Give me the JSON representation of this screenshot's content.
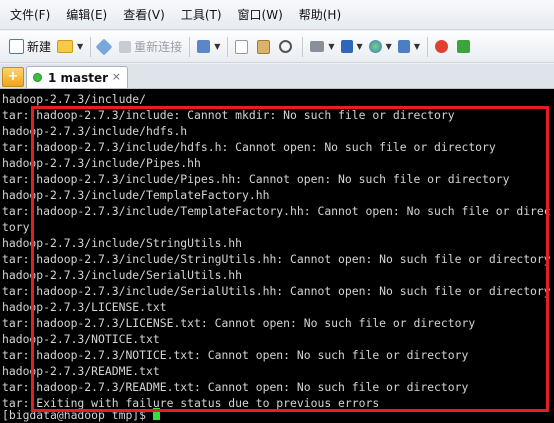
{
  "menu": [
    "文件(F)",
    "编辑(E)",
    "查看(V)",
    "工具(T)",
    "窗口(W)",
    "帮助(H)"
  ],
  "toolbar": {
    "new_label": "新建",
    "reconnect_label": "重新连接"
  },
  "tab": {
    "label": "1 master",
    "close": "×",
    "add": "+"
  },
  "terminal": {
    "lines": [
      "hadoop-2.7.3/include/",
      "tar: hadoop-2.7.3/include: Cannot mkdir: No such file or directory",
      "hadoop-2.7.3/include/hdfs.h",
      "tar: hadoop-2.7.3/include/hdfs.h: Cannot open: No such file or directory",
      "hadoop-2.7.3/include/Pipes.hh",
      "tar: hadoop-2.7.3/include/Pipes.hh: Cannot open: No such file or directory",
      "hadoop-2.7.3/include/TemplateFactory.hh",
      "tar: hadoop-2.7.3/include/TemplateFactory.hh: Cannot open: No such file or direc",
      "tory",
      "hadoop-2.7.3/include/StringUtils.hh",
      "tar: hadoop-2.7.3/include/StringUtils.hh: Cannot open: No such file or directory",
      "hadoop-2.7.3/include/SerialUtils.hh",
      "tar: hadoop-2.7.3/include/SerialUtils.hh: Cannot open: No such file or directory",
      "hadoop-2.7.3/LICENSE.txt",
      "tar: hadoop-2.7.3/LICENSE.txt: Cannot open: No such file or directory",
      "hadoop-2.7.3/NOTICE.txt",
      "tar: hadoop-2.7.3/NOTICE.txt: Cannot open: No such file or directory",
      "hadoop-2.7.3/README.txt",
      "tar: hadoop-2.7.3/README.txt: Cannot open: No such file or directory",
      "tar: Exiting with failure status due to previous errors"
    ],
    "prompt": "[bigdata@hadoop tmp]$ "
  },
  "colors": {
    "highlight": "#e31e24",
    "cursor": "#3ddc3d",
    "text": "#d4d4d4",
    "background": "#000000"
  }
}
